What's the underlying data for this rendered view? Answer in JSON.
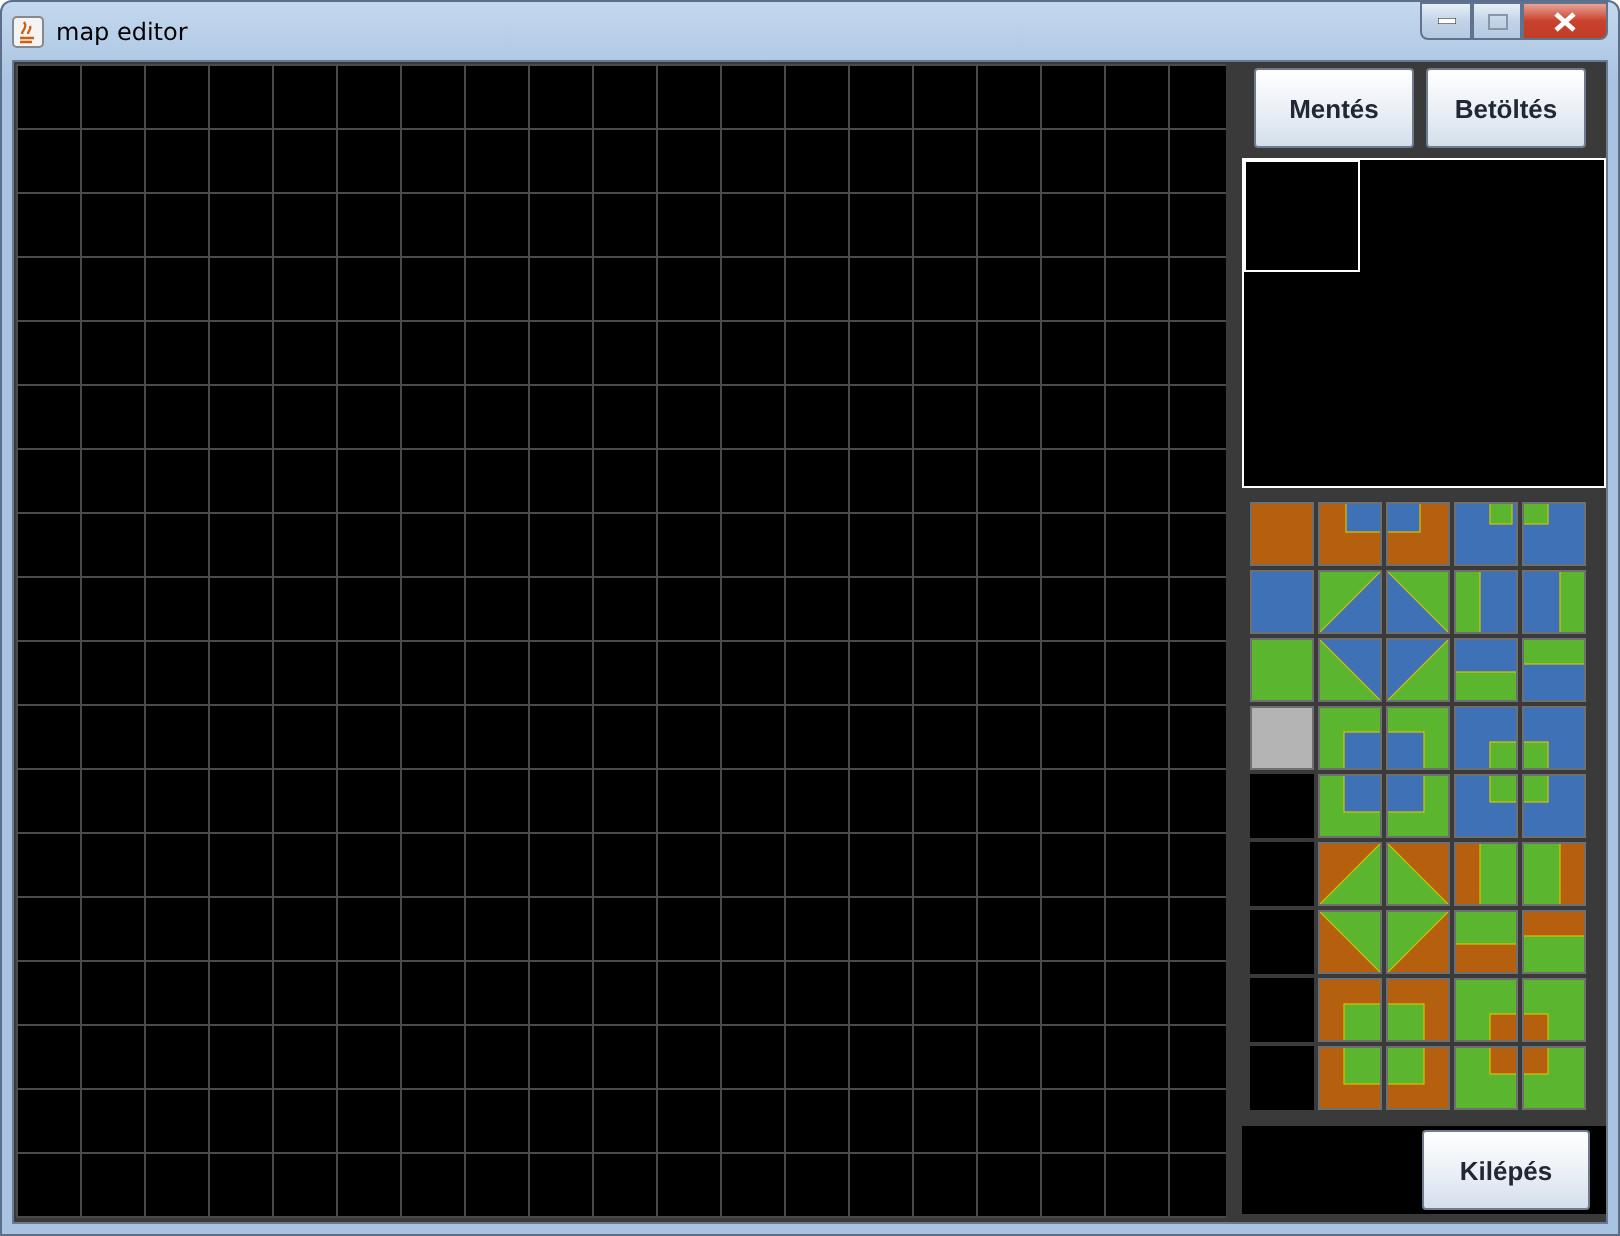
{
  "window": {
    "title": "map editor"
  },
  "buttons": [
    {
      "label": "Mentés"
    },
    {
      "label": "Betöltés"
    }
  ],
  "exit_button": {
    "label": "Kilépés"
  }
}
